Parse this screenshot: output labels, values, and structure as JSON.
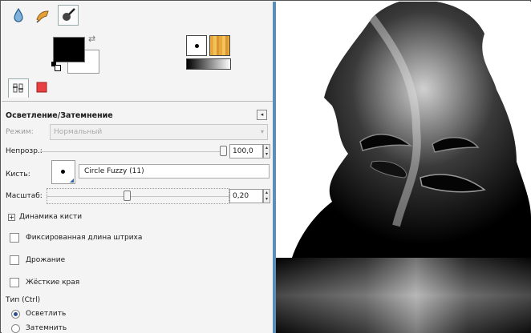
{
  "toolbox": {
    "tabs": [
      {
        "icon": "water-drop-icon"
      },
      {
        "icon": "smudge-icon"
      },
      {
        "icon": "dodge-burn-icon"
      }
    ],
    "colors": {
      "foreground": "#000000",
      "background": "#ffffff"
    },
    "previews": {
      "brush_icon": "brush-preview-icon",
      "pattern_icon": "pattern-preview-icon",
      "gradient_icon": "gradient-preview-icon"
    }
  },
  "dock_tabs": [
    {
      "icon": "tool-options-icon"
    },
    {
      "icon": "device-status-icon"
    }
  ],
  "tool_options": {
    "title": "Осветление/Затемнение",
    "mode": {
      "label": "Режим:",
      "value": "Нормальный"
    },
    "opacity": {
      "label": "Непрозр.:",
      "value": "100,0",
      "level": 1.0
    },
    "brush": {
      "label": "Кисть:",
      "name": "Circle Fuzzy (11)"
    },
    "scale": {
      "label": "Масштаб:",
      "value": "0,20",
      "level": 0.2
    },
    "dynamics": {
      "label": "Динамика кисти"
    },
    "fixed_stroke": {
      "label": "Фиксированная длина штриха",
      "checked": false
    },
    "jitter": {
      "label": "Дрожание",
      "checked": false
    },
    "hard_edges": {
      "label": "Жёсткие края",
      "checked": false
    },
    "type": {
      "label": "Тип  (Ctrl)",
      "options": [
        {
          "label": "Осветлить",
          "selected": true
        },
        {
          "label": "Затемнить",
          "selected": false
        }
      ]
    }
  },
  "accent": "#5b8fb8"
}
